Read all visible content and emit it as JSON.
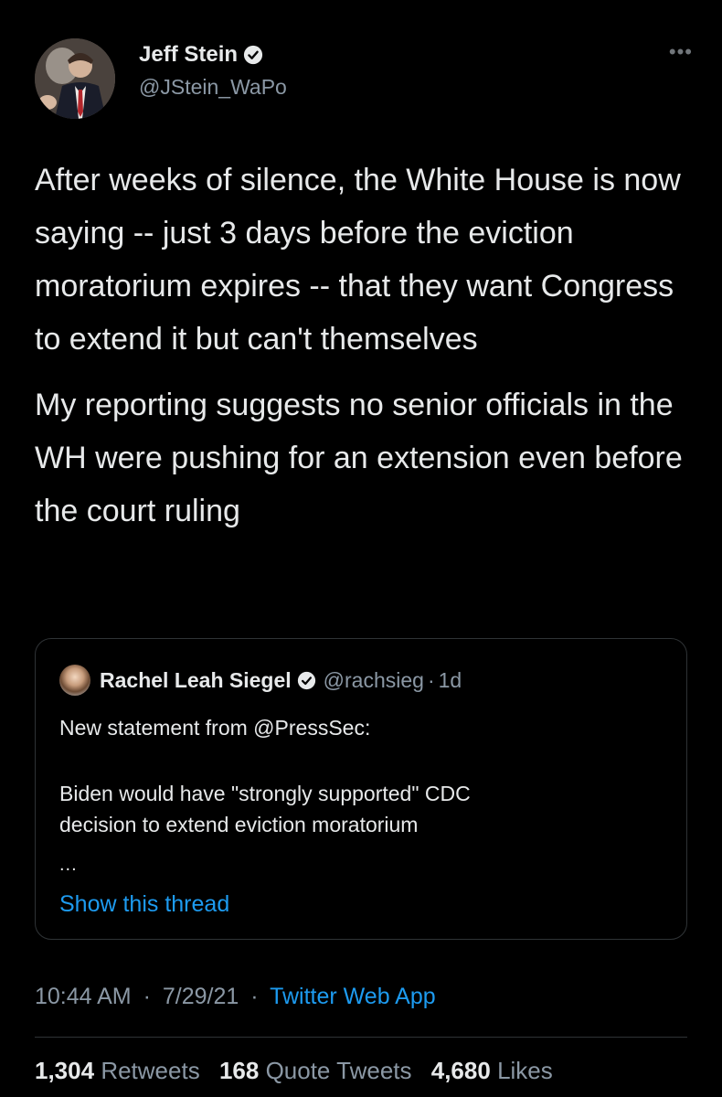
{
  "author": {
    "display_name": "Jeff Stein",
    "handle": "@JStein_WaPo",
    "verified": true
  },
  "more_icon": "more-horizontal-icon",
  "tweet": {
    "paragraphs": [
      "After weeks of silence, the White House is now saying -- just 3 days before the eviction moratorium expires -- that they want Congress to extend it but can't themselves",
      "My reporting suggests no senior officials in the WH were pushing for an extension even before the court ruling"
    ]
  },
  "quoted_tweet": {
    "display_name": "Rachel Leah Siegel",
    "handle": "@rachsieg",
    "separator": "·",
    "time": "1d",
    "line1": "New statement from @PressSec:",
    "line2": "Biden would have \"strongly supported\" CDC",
    "line3": "decision to extend eviction moratorium",
    "ellipsis": "...",
    "show_thread": "Show this thread"
  },
  "meta": {
    "time": "10:44 AM",
    "date": "7/29/21",
    "separator": "·",
    "app": "Twitter Web App"
  },
  "stats": {
    "retweets_count": "1,304",
    "retweets_label": "Retweets",
    "quotes_count": "168",
    "quotes_label": "Quote Tweets",
    "likes_count": "4,680",
    "likes_label": "Likes"
  },
  "colors": {
    "background": "#000000",
    "text": "#e7e9ea",
    "secondary": "#8b98a5",
    "accent": "#1d9bf0",
    "border": "#2f3336"
  }
}
